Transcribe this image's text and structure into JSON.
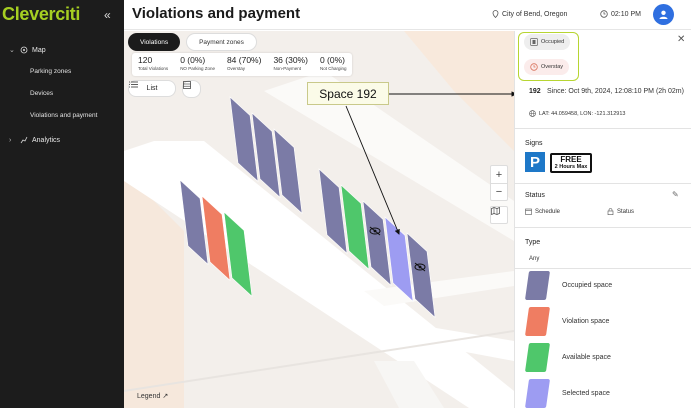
{
  "app": {
    "logo": "Cleverciti",
    "collapse_icon": "double-chevron-left-icon"
  },
  "sidebar": {
    "sections": [
      {
        "label": "Map",
        "expanded": true,
        "items": [
          "Parking zones",
          "Devices",
          "Violations and payment"
        ]
      },
      {
        "label": "Analytics",
        "expanded": false,
        "items": []
      }
    ]
  },
  "header": {
    "title": "Violations and payment",
    "location": "City of Bend, Oregon",
    "time": "02:10 PM"
  },
  "map": {
    "tabs": [
      {
        "label": "Violations",
        "active": true
      },
      {
        "label": "Payment zones",
        "active": false
      }
    ],
    "stats": [
      {
        "value": "120",
        "label": "Total Violations"
      },
      {
        "value": "0 (0%)",
        "label": "NO Parking Zone"
      },
      {
        "value": "84 (70%)",
        "label": "Overstay"
      },
      {
        "value": "36 (30%)",
        "label": "Non-Payment"
      },
      {
        "value": "0 (0%)",
        "label": "Not Charging"
      }
    ],
    "list_label": "List",
    "legend_label": "Legend",
    "callout": "Space 192",
    "colors": {
      "occupied": "#7b7ba6",
      "violation": "#ef7d62",
      "available": "#4fc76b",
      "selected": "#9d9cf2"
    }
  },
  "panel": {
    "chips": [
      {
        "label": "Occupied",
        "icon": "car-icon"
      },
      {
        "label": "Overstay",
        "icon": "clock-icon"
      }
    ],
    "space_id": "192",
    "since": "Since: Oct 9th, 2024, 12:08:10 PM (2h 02m)",
    "latlon": "LAT: 44.059458, LON: -121.312913",
    "signs_title": "Signs",
    "sign_p": "P",
    "sign_free_line1": "FREE",
    "sign_free_line2": "2 Hours Max",
    "status_title": "Status",
    "status_items": [
      {
        "label": "Schedule",
        "icon": "calendar-icon"
      },
      {
        "label": "Status",
        "icon": "lock-icon"
      }
    ],
    "type_title": "Type",
    "type_any": "Any",
    "legend": [
      {
        "label": "Occupied space",
        "color": "#7b7ba6"
      },
      {
        "label": "Violation space",
        "color": "#ef7d62"
      },
      {
        "label": "Available space",
        "color": "#4fc76b"
      },
      {
        "label": "Selected space",
        "color": "#9d9cf2"
      }
    ]
  }
}
